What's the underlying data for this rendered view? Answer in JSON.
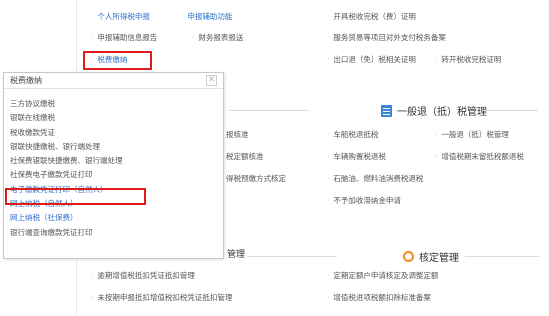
{
  "top_links": [
    {
      "label": "个人所得税申报",
      "color": "blue"
    },
    {
      "label": "申报辅助功能",
      "color": "blue"
    },
    {
      "label": "开具税收完税（费）证明",
      "color": "gray"
    },
    {
      "label": "申报辅助信息报告",
      "color": "gray"
    },
    {
      "label": "财务报表报送",
      "color": "gray"
    },
    {
      "label": "服务贸易等项目对外支付税务备案",
      "color": "gray"
    },
    {
      "label": "税费缴纳",
      "color": "blue"
    },
    {
      "label": "出口退（免）税相关证明",
      "color": "gray"
    },
    {
      "label": "转开税收完税证明",
      "color": "gray"
    }
  ],
  "tax_refund_section": {
    "title": "一般退（抵）税管理",
    "icon": "document-icon",
    "items": [
      "报核准",
      "车船税退抵税",
      "一般退（抵）税管理",
      "税定额核准",
      "车辆购置税退税",
      "增值税期末留抵税额退税",
      "得税预缴方式核定",
      "石脑油、燃料油消费税退税",
      "不予加收滞纳金申请"
    ]
  },
  "verification_section": {
    "title": "核定管理",
    "icon": "gear-icon",
    "left_head_fragment": "管理",
    "items": [
      "逾期增值税抵扣凭证抵扣管理",
      "定期定额户申请核定及调整定额",
      "未按期申报抵扣增值税扣税凭证抵扣管理",
      "增值税进项税额扣除标准备案"
    ]
  },
  "popup": {
    "title": "税费缴纳",
    "close_symbol": "✕",
    "items": [
      {
        "label": "三方协议缴税",
        "color": "gray"
      },
      {
        "label": "银联在线缴税",
        "color": "gray"
      },
      {
        "label": "税收缴款凭证",
        "color": "gray"
      },
      {
        "label": "银联快捷缴税、银行端处理",
        "color": "gray"
      },
      {
        "label": "社保费银联快捷缴费、银行端处理",
        "color": "gray"
      },
      {
        "label": "社保费电子缴款凭证打印",
        "color": "gray"
      },
      {
        "label": "电子缴款凭证打印（自然人）",
        "color": "blue"
      },
      {
        "label": "网上纳税（自然人）",
        "color": "blue"
      },
      {
        "label": "网上纳税（社保费）",
        "color": "blue"
      },
      {
        "label": "银行端查询缴款凭证打印",
        "color": "gray"
      }
    ]
  },
  "colors": {
    "link_blue": "#2b73c9",
    "highlight_red": "#e01b1b",
    "gear_orange": "#f08c1e",
    "doc_blue": "#3a85d6"
  }
}
